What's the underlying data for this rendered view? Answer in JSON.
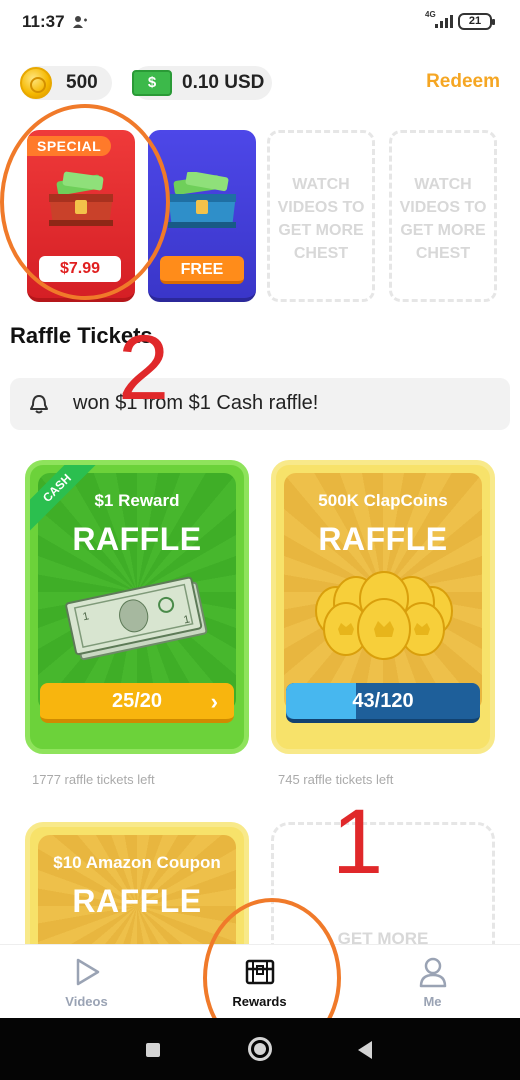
{
  "status_bar": {
    "time": "11:37",
    "network": "4G",
    "battery": "21"
  },
  "balances": {
    "coins": "500",
    "usd": "0.10 USD",
    "redeem_label": "Redeem",
    "cash_symbol": "$"
  },
  "chests": [
    {
      "ribbon": "SPECIAL",
      "price": "$7.99",
      "color": "#e8282c"
    },
    {
      "label": "FREE",
      "color": "#4440dc"
    },
    {
      "text": "WATCH VIDEOS TO GET MORE CHEST"
    },
    {
      "text": "WATCH VIDEOS TO GET MORE CHEST"
    }
  ],
  "annotations": {
    "number_1": "1",
    "number_2": "2",
    "color": "#f07a2a",
    "number_color": "#e0282a"
  },
  "raffle": {
    "section_title": "Raffle Tickets",
    "notice": "won $1 from $1 Cash raffle!",
    "cards": [
      {
        "corner_badge": "CASH",
        "title": "$1 Reward",
        "big": "RAFFLE",
        "progress": "25/20",
        "arrow": "›",
        "tickets_left": "1777 raffle tickets left",
        "color": "#6cd23a"
      },
      {
        "title": "500K ClapCoins",
        "big": "RAFFLE",
        "progress": "43/120",
        "progress_fraction": 0.36,
        "tickets_left": "745 raffle tickets left",
        "color": "#f7e26a"
      },
      {
        "title": "$10 Amazon Coupon",
        "big": "RAFFLE"
      }
    ],
    "empty_card_text": "GET MORE"
  },
  "bottom_nav": {
    "items": [
      {
        "label": "Videos",
        "icon": "play-icon",
        "active": false
      },
      {
        "label": "Rewards",
        "icon": "chest-icon",
        "active": true
      },
      {
        "label": "Me",
        "icon": "person-icon",
        "active": false
      }
    ]
  },
  "system_nav": {
    "recent": "square-icon",
    "home": "circle-icon",
    "back": "triangle-icon"
  }
}
